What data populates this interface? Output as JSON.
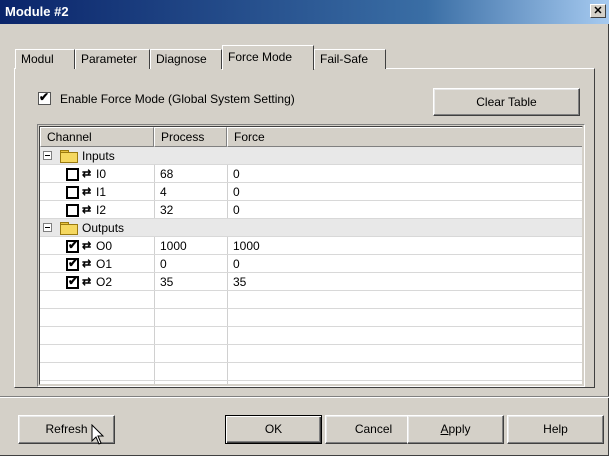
{
  "window": {
    "title": "Module #2",
    "close_glyph": "✕"
  },
  "tabs": [
    {
      "label": "Modul",
      "active": false
    },
    {
      "label": "Parameter",
      "active": false
    },
    {
      "label": "Diagnose",
      "active": false
    },
    {
      "label": "Force Mode",
      "active": true
    },
    {
      "label": "Fail-Safe",
      "active": false
    }
  ],
  "force_mode": {
    "enable_label": "Enable Force Mode (Global System Setting)",
    "enable_checked": true,
    "clear_table_label": "Clear Table"
  },
  "table": {
    "columns": [
      "Channel",
      "Process",
      "Force"
    ],
    "groups": [
      {
        "name": "Inputs",
        "channels": [
          {
            "name": "I0",
            "process": "68",
            "force": "0",
            "checked": false
          },
          {
            "name": "I1",
            "process": "4",
            "force": "0",
            "checked": false
          },
          {
            "name": "I2",
            "process": "32",
            "force": "0",
            "checked": false
          }
        ]
      },
      {
        "name": "Outputs",
        "channels": [
          {
            "name": "O0",
            "process": "1000",
            "force": "1000",
            "checked": true
          },
          {
            "name": "O1",
            "process": "0",
            "force": "0",
            "checked": true
          },
          {
            "name": "O2",
            "process": "35",
            "force": "35",
            "checked": true
          }
        ]
      }
    ]
  },
  "buttons": {
    "refresh": "Refresh",
    "ok": "OK",
    "cancel": "Cancel",
    "apply_prefix": "A",
    "apply_rest": "pply",
    "help": "Help"
  },
  "icons": {
    "check": "✔",
    "arrows": "⇄"
  },
  "colors": {
    "titlebar_start": "#0a246a",
    "titlebar_end": "#a6caf0",
    "face": "#d4d0c8",
    "folder": "#f5d860"
  }
}
